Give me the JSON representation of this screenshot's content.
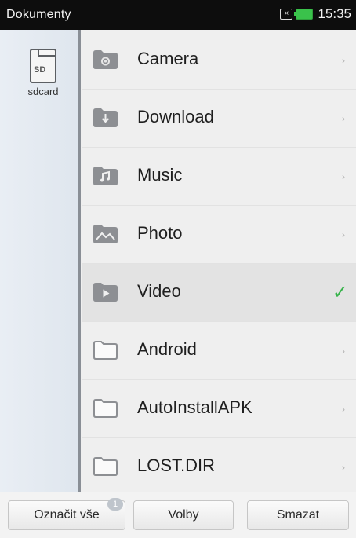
{
  "status_bar": {
    "title": "Dokumenty",
    "time": "15:35",
    "notification_glyph": "×"
  },
  "sidebar": {
    "storage_label": "sdcard",
    "storage_badge": "SD"
  },
  "folders": [
    {
      "name": "Camera",
      "icon": "camera-folder-icon"
    },
    {
      "name": "Download",
      "icon": "download-folder-icon"
    },
    {
      "name": "Music",
      "icon": "music-folder-icon"
    },
    {
      "name": "Photo",
      "icon": "photo-folder-icon"
    },
    {
      "name": "Video",
      "icon": "video-folder-icon",
      "selected": true
    },
    {
      "name": "Android",
      "icon": "folder-icon"
    },
    {
      "name": "AutoInstallAPK",
      "icon": "folder-icon"
    },
    {
      "name": "LOST.DIR",
      "icon": "folder-icon"
    }
  ],
  "bottom_bar": {
    "mark_all_label": "Označit vše",
    "mark_all_badge": "1",
    "options_label": "Volby",
    "delete_label": "Smazat"
  },
  "colors": {
    "check": "#36b34a",
    "status_bar_bg": "#0d0d0d",
    "battery": "#3ac24b"
  }
}
